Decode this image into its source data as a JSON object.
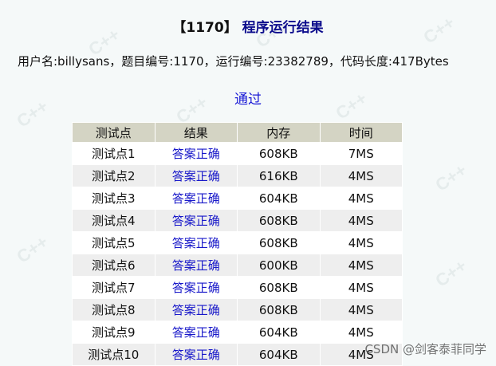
{
  "header": {
    "problem_id": "【1170】",
    "title": "程序运行结果"
  },
  "info": "用户名:billysans，题目编号:1170，运行编号:23382789，代码长度:417Bytes",
  "status": "通过",
  "table": {
    "columns": [
      "测试点",
      "结果",
      "内存",
      "时间"
    ],
    "rows": [
      {
        "point": "测试点1",
        "result": "答案正确",
        "memory": "608KB",
        "time": "7MS"
      },
      {
        "point": "测试点2",
        "result": "答案正确",
        "memory": "616KB",
        "time": "4MS"
      },
      {
        "point": "测试点3",
        "result": "答案正确",
        "memory": "604KB",
        "time": "4MS"
      },
      {
        "point": "测试点4",
        "result": "答案正确",
        "memory": "608KB",
        "time": "4MS"
      },
      {
        "point": "测试点5",
        "result": "答案正确",
        "memory": "608KB",
        "time": "4MS"
      },
      {
        "point": "测试点6",
        "result": "答案正确",
        "memory": "600KB",
        "time": "4MS"
      },
      {
        "point": "测试点7",
        "result": "答案正确",
        "memory": "608KB",
        "time": "4MS"
      },
      {
        "point": "测试点8",
        "result": "答案正确",
        "memory": "608KB",
        "time": "4MS"
      },
      {
        "point": "测试点9",
        "result": "答案正确",
        "memory": "604KB",
        "time": "4MS"
      },
      {
        "point": "测试点10",
        "result": "答案正确",
        "memory": "604KB",
        "time": "4MS"
      }
    ]
  },
  "watermark_text": "C++",
  "watermark_attribution": "CSDN @剑客泰菲同学"
}
